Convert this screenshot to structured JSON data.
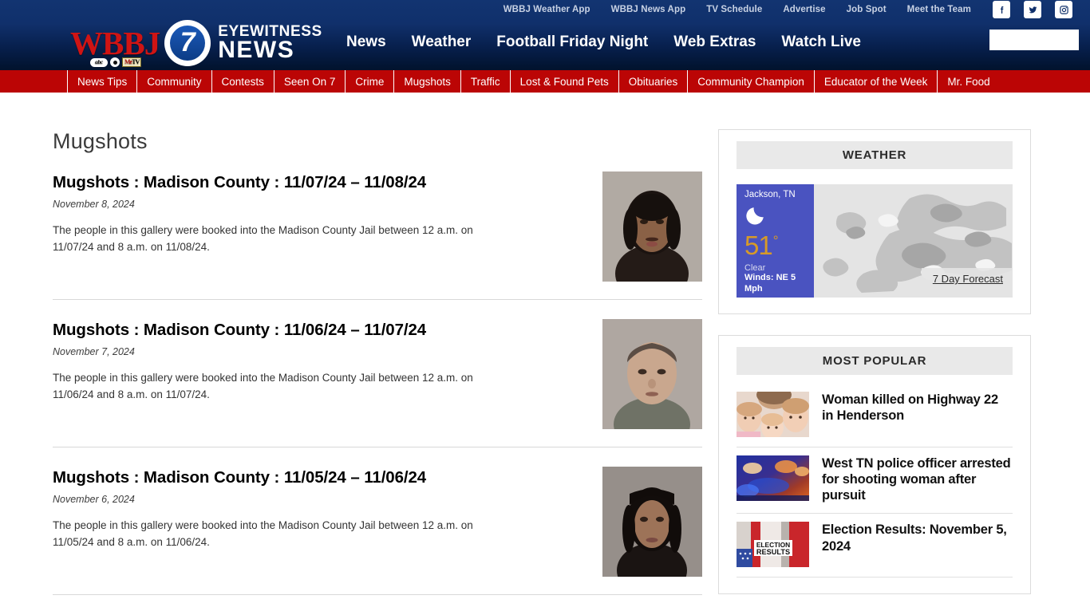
{
  "header": {
    "logo": {
      "callsign": "WBBJ",
      "channel_number": "7",
      "eyewitness": "EYEWITNESS",
      "news": "NEWS",
      "badge_abc": "abc",
      "badge_metv_me": "Me",
      "badge_metv_tv": "TV"
    },
    "top_links": [
      {
        "label": "WBBJ Weather App"
      },
      {
        "label": "WBBJ News App"
      },
      {
        "label": "TV Schedule"
      },
      {
        "label": "Advertise"
      },
      {
        "label": "Job Spot"
      },
      {
        "label": "Meet the Team"
      }
    ],
    "social": [
      {
        "name": "facebook-icon"
      },
      {
        "name": "twitter-icon"
      },
      {
        "name": "instagram-icon"
      }
    ],
    "primary_nav": [
      {
        "label": "News"
      },
      {
        "label": "Weather"
      },
      {
        "label": "Football Friday Night"
      },
      {
        "label": "Web Extras"
      },
      {
        "label": "Watch Live"
      }
    ],
    "search": {
      "value": "",
      "placeholder": "",
      "icon": "search-icon"
    },
    "section_nav": [
      {
        "label": "News Tips"
      },
      {
        "label": "Community"
      },
      {
        "label": "Contests"
      },
      {
        "label": "Seen On 7"
      },
      {
        "label": "Crime"
      },
      {
        "label": "Mugshots"
      },
      {
        "label": "Traffic"
      },
      {
        "label": "Lost & Found Pets"
      },
      {
        "label": "Obituaries"
      },
      {
        "label": "Community Champion"
      },
      {
        "label": "Educator of the Week"
      },
      {
        "label": "Mr. Food"
      }
    ],
    "colors": {
      "header_top": "#123471",
      "header_bottom": "#01122c",
      "section_nav_red": "#bb0505",
      "logo_red": "#cf1414"
    }
  },
  "main": {
    "page_title": "Mugshots",
    "articles": [
      {
        "title": "Mugshots : Madison County : 11/07/24 – 11/08/24",
        "date": "November 8, 2024",
        "excerpt": "The people in this gallery were booked into the Madison County Jail between 12 a.m. on 11/07/24 and 8 a.m. on 11/08/24.",
        "thumb_alt": "mugshot-photo-1"
      },
      {
        "title": "Mugshots : Madison County : 11/06/24 – 11/07/24",
        "date": "November 7, 2024",
        "excerpt": "The people in this gallery were booked into the Madison County Jail between 12 a.m. on 11/06/24 and 8 a.m. on 11/07/24.",
        "thumb_alt": "mugshot-photo-2"
      },
      {
        "title": "Mugshots : Madison County : 11/05/24 – 11/06/24",
        "date": "November 6, 2024",
        "excerpt": "The people in this gallery were booked into the Madison County Jail between 12 a.m. on 11/05/24 and 8 a.m. on 11/06/24.",
        "thumb_alt": "mugshot-photo-3"
      }
    ]
  },
  "sidebar": {
    "weather": {
      "heading": "WEATHER",
      "city": "Jackson, TN",
      "temperature": "51",
      "degree_symbol": "°",
      "condition": "Clear",
      "winds": "Winds: NE 5 Mph",
      "forecast_link": "7 Day Forecast",
      "icon": "moon-icon",
      "panel_color": "#4a53c0",
      "temp_color": "#d79a28"
    },
    "most_popular": {
      "heading": "MOST POPULAR",
      "items": [
        {
          "title": "Woman killed on Highway 22 in Henderson",
          "thumb_alt": "family-photo-thumb"
        },
        {
          "title": "West TN police officer arrested for shooting woman after pursuit",
          "thumb_alt": "police-lights-thumb"
        },
        {
          "title": "Election Results: November 5, 2024",
          "thumb_alt": "election-results-thumb"
        }
      ]
    }
  }
}
